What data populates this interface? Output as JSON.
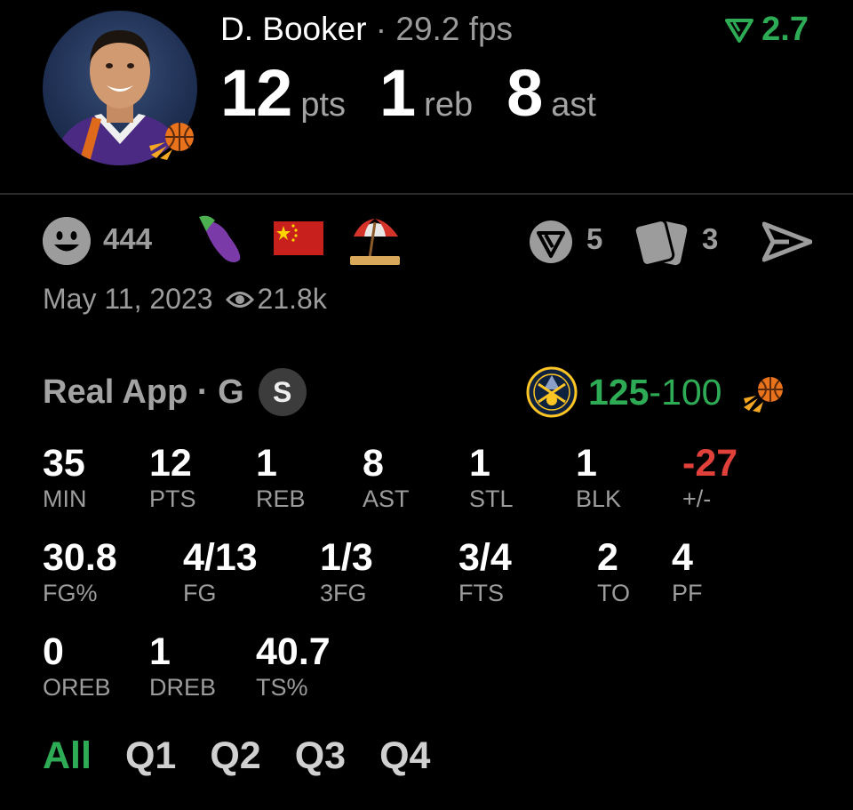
{
  "player": {
    "name": "D. Booker",
    "separator": "·",
    "fps": "29.2 fps",
    "avatar": "player-headshot",
    "team_logo": "suns-logo"
  },
  "delta": {
    "icon": "down-triangle-icon",
    "value": "2.7",
    "color": "#2eab55"
  },
  "headline": {
    "pts": {
      "value": "12",
      "unit": "pts"
    },
    "reb": {
      "value": "1",
      "unit": "reb"
    },
    "ast": {
      "value": "8",
      "unit": "ast"
    }
  },
  "reactions": {
    "smiley_count": "444",
    "emojis": [
      "eggplant-emoji",
      "china-flag-emoji",
      "beach-umbrella-emoji"
    ],
    "v_count": "5",
    "cards_count": "3"
  },
  "meta": {
    "date": "May 11, 2023",
    "views": "21.8k"
  },
  "game": {
    "source": "Real App",
    "dot": "·",
    "position": "G",
    "badge": "S",
    "score_win": "125",
    "score_sep": "-",
    "score_lose": "100",
    "home_logo": "nuggets-logo",
    "away_logo": "suns-logo"
  },
  "stats": [
    {
      "value": "35",
      "label": "MIN"
    },
    {
      "value": "12",
      "label": "PTS"
    },
    {
      "value": "1",
      "label": "REB"
    },
    {
      "value": "8",
      "label": "AST"
    },
    {
      "value": "1",
      "label": "STL"
    },
    {
      "value": "1",
      "label": "BLK"
    },
    {
      "value": "-27",
      "label": "+/-"
    },
    {
      "value": "30.8",
      "label": "FG%"
    },
    {
      "value": "4/13",
      "label": "FG"
    },
    {
      "value": "1/3",
      "label": "3FG"
    },
    {
      "value": "3/4",
      "label": "FTS"
    },
    {
      "value": "2",
      "label": "TO"
    },
    {
      "value": "4",
      "label": "PF"
    },
    {
      "value": "0",
      "label": "OREB"
    },
    {
      "value": "1",
      "label": "DREB"
    },
    {
      "value": "40.7",
      "label": "TS%"
    }
  ],
  "tabs": [
    {
      "label": "All",
      "active": true
    },
    {
      "label": "Q1"
    },
    {
      "label": "Q2"
    },
    {
      "label": "Q3"
    },
    {
      "label": "Q4"
    }
  ],
  "colors": {
    "accent": "#2eab55",
    "negative": "#e0413a",
    "muted": "#9c9c9c"
  }
}
